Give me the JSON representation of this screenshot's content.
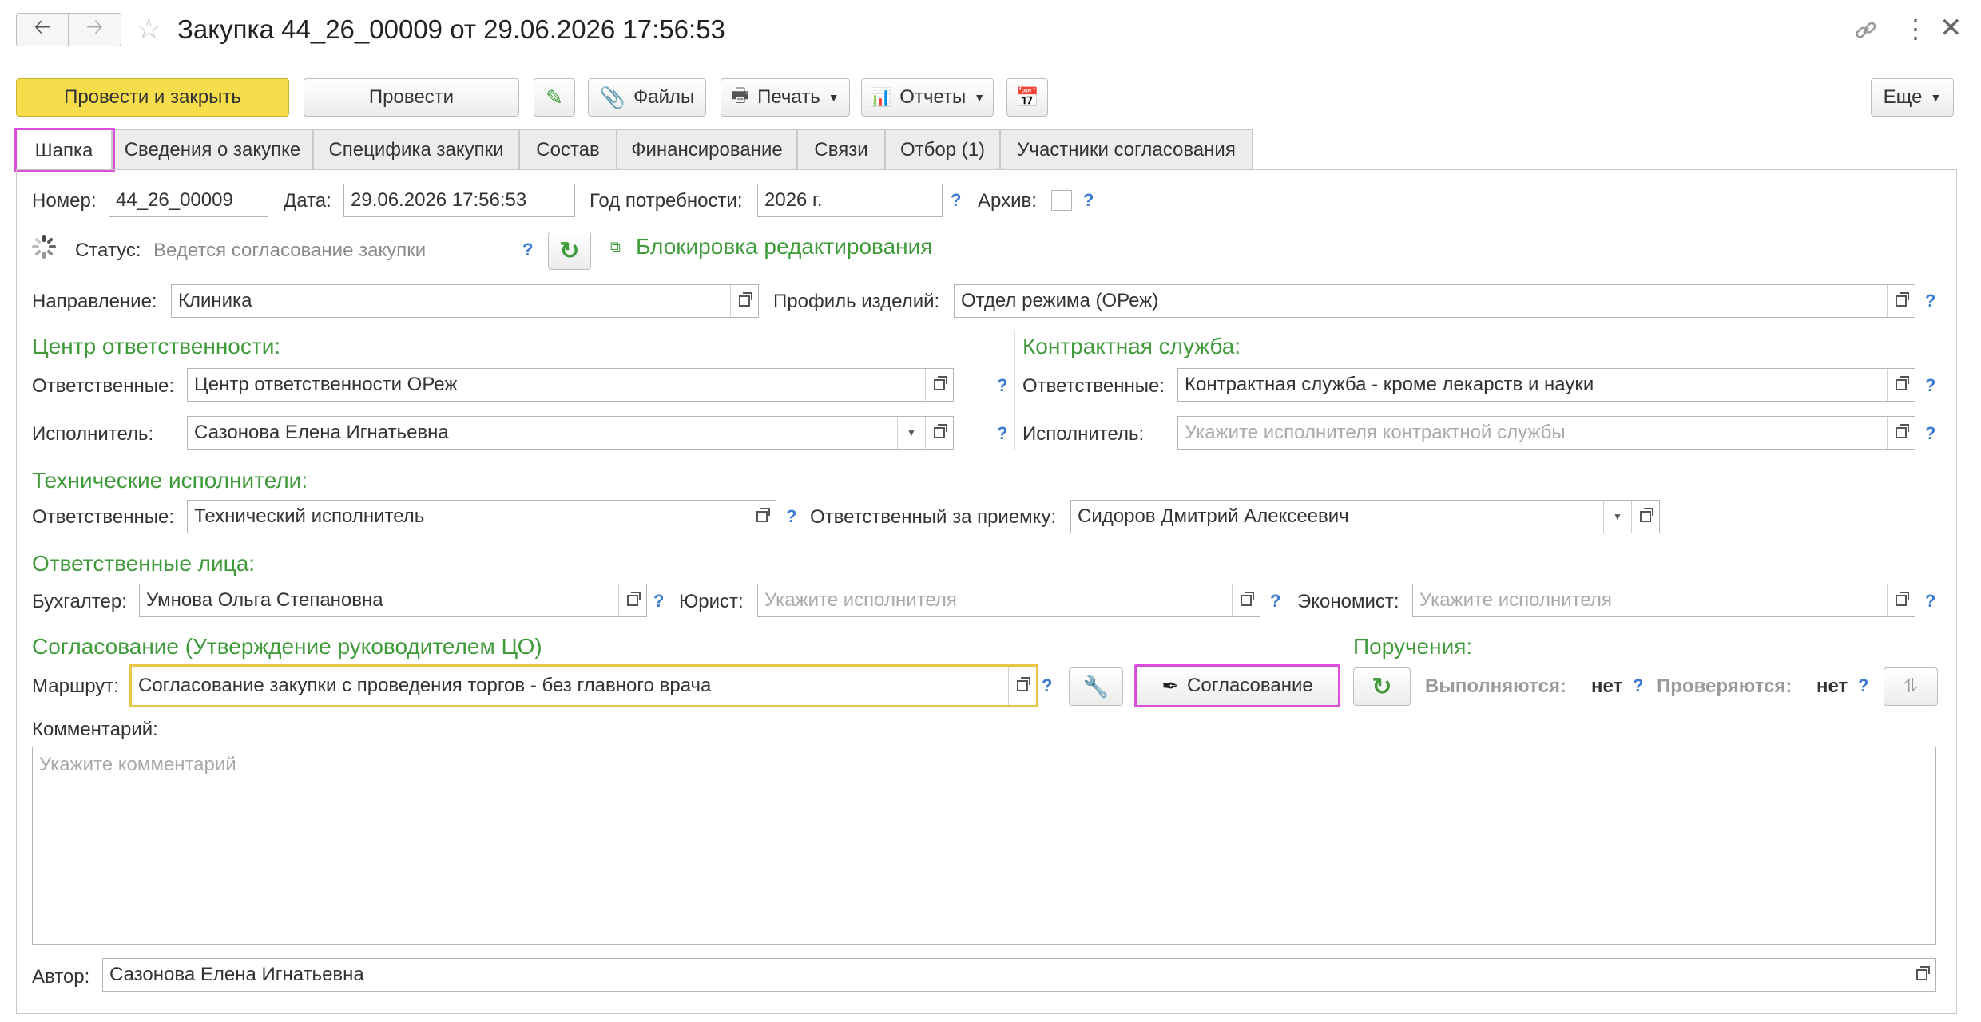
{
  "window": {
    "title": "Закупка 44_26_00009 от 29.06.2026 17:56:53",
    "icons": [
      "back-arrow-icon",
      "forward-arrow-icon",
      "star-icon",
      "link-icon",
      "more-vertical-icon",
      "close-icon"
    ]
  },
  "toolbar": {
    "post_and_close": "Провести и закрыть",
    "post": "Провести",
    "files": "Файлы",
    "print": "Печать",
    "reports": "Отчеты",
    "more": "Еще"
  },
  "tabs": [
    {
      "label": "Шапка"
    },
    {
      "label": "Сведения о закупке"
    },
    {
      "label": "Специфика закупки"
    },
    {
      "label": "Состав"
    },
    {
      "label": "Финансирование"
    },
    {
      "label": "Связи"
    },
    {
      "label": "Отбор (1)"
    },
    {
      "label": "Участники согласования"
    }
  ],
  "header": {
    "number_label": "Номер:",
    "number_value": "44_26_00009",
    "date_label": "Дата:",
    "date_value": "29.06.2026 17:56:53",
    "year_label": "Год потребности:",
    "year_value": "2026 г.",
    "archive_label": "Архив:",
    "help": "?"
  },
  "status": {
    "label": "Статус:",
    "value": "Ведется согласование закупки",
    "lock_link": "Блокировка редактирования"
  },
  "direction": {
    "label": "Направление:",
    "value": "Клиника",
    "profile_label": "Профиль изделий:",
    "profile_value": "Отдел режима (ОРеж)"
  },
  "responsibility_center": {
    "title": "Центр ответственности:",
    "responsible_label": "Ответственные:",
    "responsible_value": "Центр ответственности ОРеж",
    "executor_label": "Исполнитель:",
    "executor_value": "Сазонова Елена Игнатьевна"
  },
  "contract_service": {
    "title": "Контрактная служба:",
    "responsible_label": "Ответственные:",
    "responsible_value": "Контрактная служба - кроме лекарств и науки",
    "executor_label": "Исполнитель:",
    "executor_placeholder": "Укажите исполнителя контрактной службы"
  },
  "technical": {
    "title": "Технические исполнители:",
    "responsible_label": "Ответственные:",
    "responsible_value": "Технический исполнитель",
    "acceptance_label": "Ответственный за приемку:",
    "acceptance_value": "Сидоров Дмитрий Алексеевич"
  },
  "persons": {
    "title": "Ответственные лица:",
    "accountant_label": "Бухгалтер:",
    "accountant_value": "Умнова Ольга Степановна",
    "lawyer_label": "Юрист:",
    "lawyer_placeholder": "Укажите исполнителя",
    "economist_label": "Экономист:",
    "economist_placeholder": "Укажите исполнителя"
  },
  "approval": {
    "title": "Согласование (Утверждение руководителем ЦО)",
    "route_label": "Маршрут:",
    "route_value": "Согласование закупки с проведения торгов - без главного врача",
    "approval_button": "Согласование"
  },
  "assignments": {
    "title": "Поручения:",
    "executing_label": "Выполняются:",
    "executing_value": "нет",
    "checking_label": "Проверяются:",
    "checking_value": "нет"
  },
  "comment": {
    "label": "Комментарий:",
    "placeholder": "Укажите комментарий"
  },
  "author": {
    "label": "Автор:",
    "value": "Сазонова Елена Игнатьевна"
  },
  "colors": {
    "accent_green": "#3f9a3a",
    "primary_yellow": "#f5dd4b",
    "highlight_magenta": "#d94fd9",
    "highlight_yellow": "#e8c547",
    "help_blue": "#3b7bd1"
  }
}
